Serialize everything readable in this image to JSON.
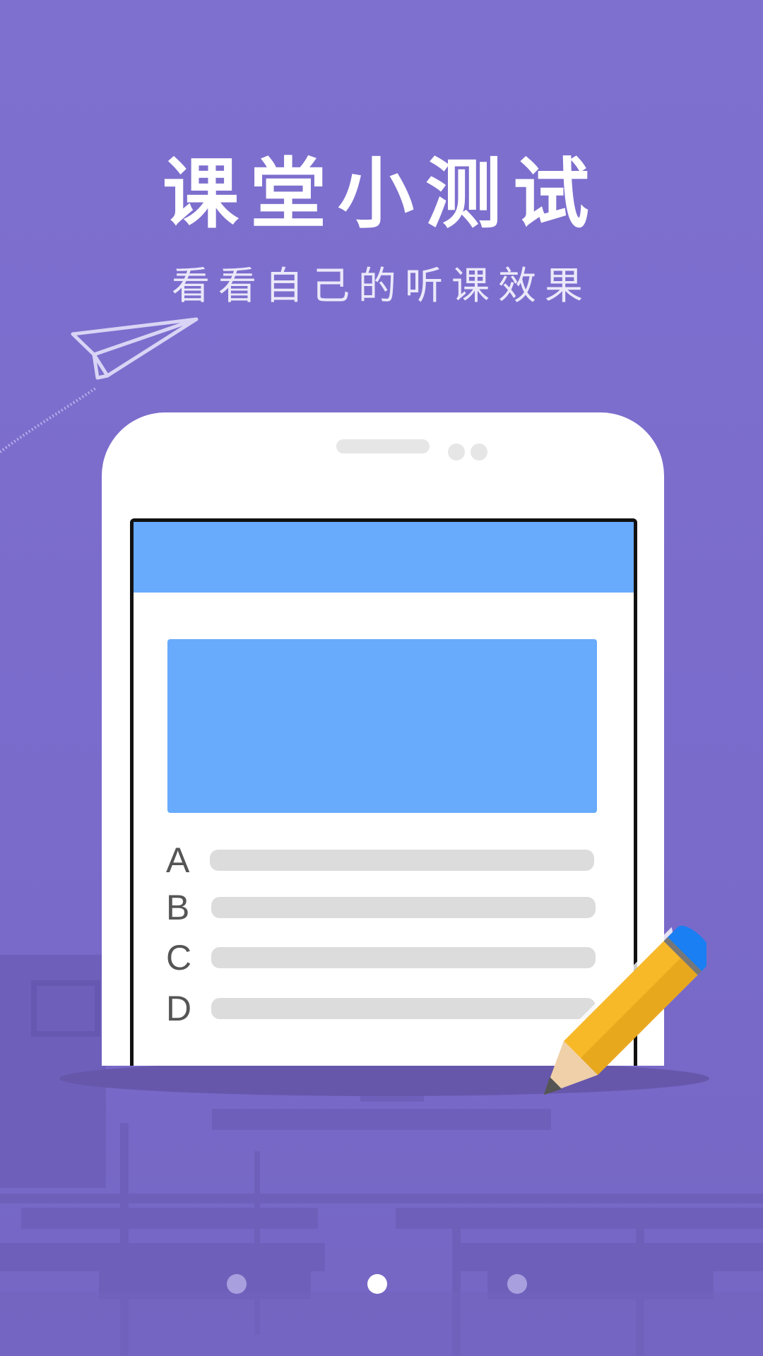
{
  "title": "课堂小测试",
  "subtitle": "看看自己的听课效果",
  "options": [
    {
      "letter": "A"
    },
    {
      "letter": "B"
    },
    {
      "letter": "C"
    },
    {
      "letter": "D"
    }
  ],
  "icons": {
    "paper_plane": "paper-plane-icon",
    "pencil": "pencil-icon"
  },
  "pagination": {
    "count": 3,
    "active_index": 1
  },
  "colors": {
    "background": "#7b6dcb",
    "app_header": "#68aafc",
    "pencil_body": "#f7b928",
    "pencil_eraser": "#1a7ff2"
  }
}
